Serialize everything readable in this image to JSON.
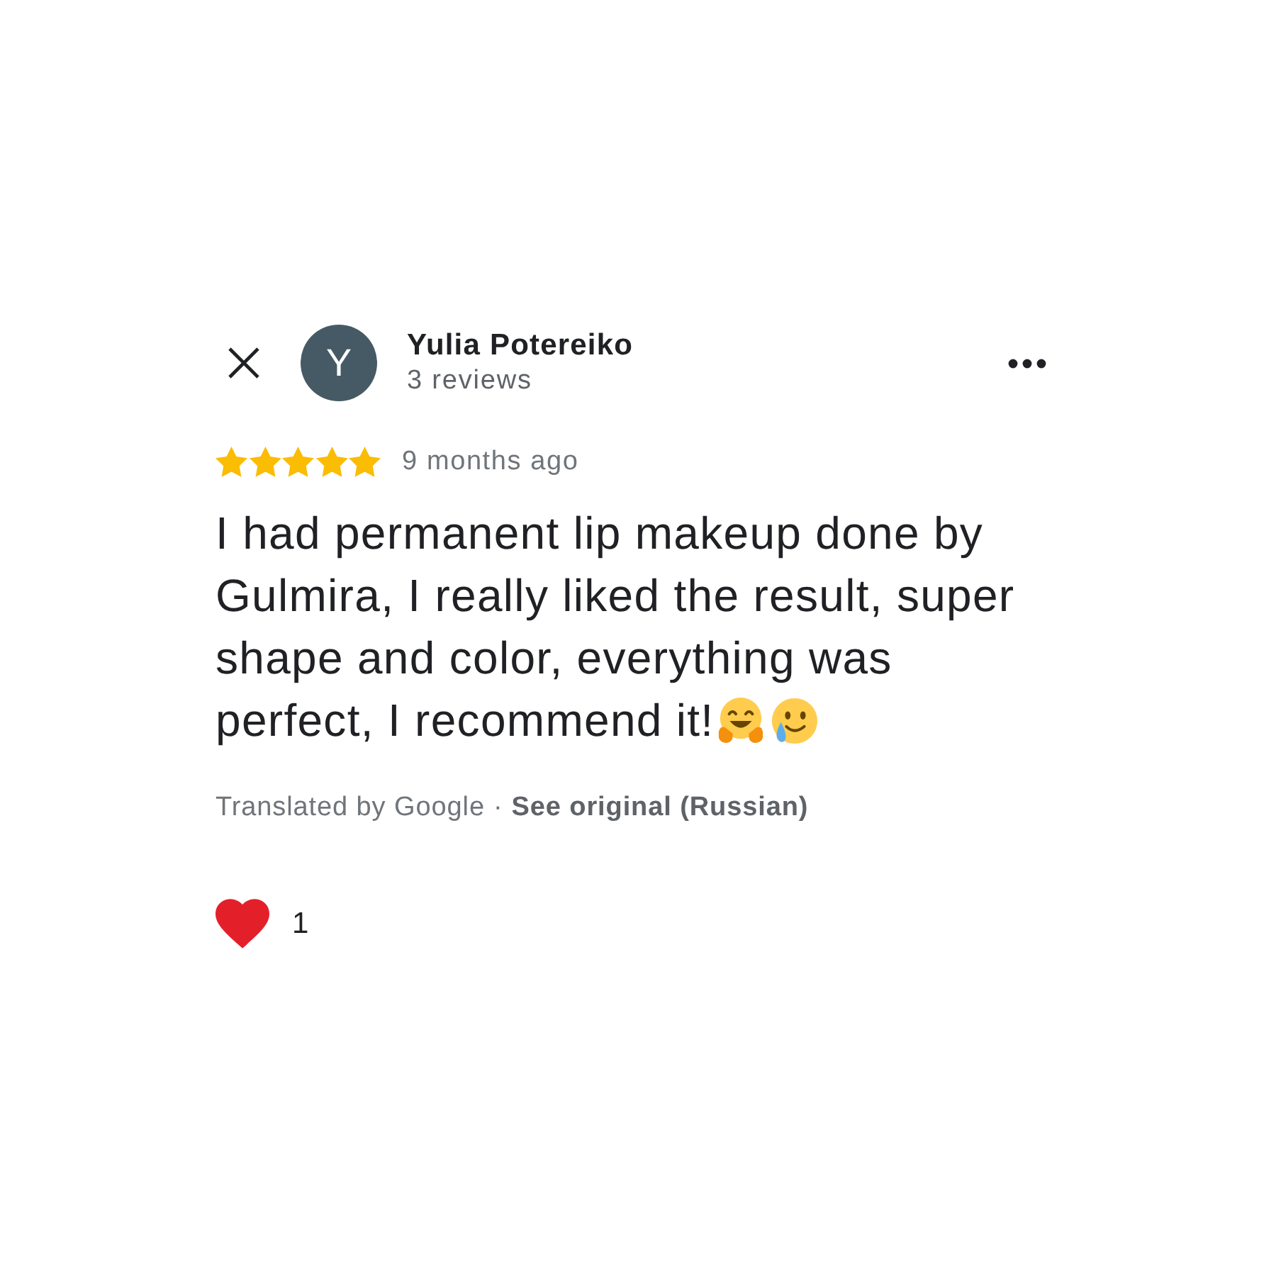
{
  "author": {
    "initial": "Y",
    "name": "Yulia Potereiko",
    "review_count": "3 reviews"
  },
  "review": {
    "stars": 5,
    "time": "9 months ago",
    "text": "I had permanent lip makeup done by Gulmira, I really liked the result, super shape and color, everything was perfect, I recommend it!"
  },
  "translation": {
    "note": "Translated by Google",
    "separator": "·",
    "link": "See original (Russian)"
  },
  "reaction": {
    "count": "1"
  }
}
